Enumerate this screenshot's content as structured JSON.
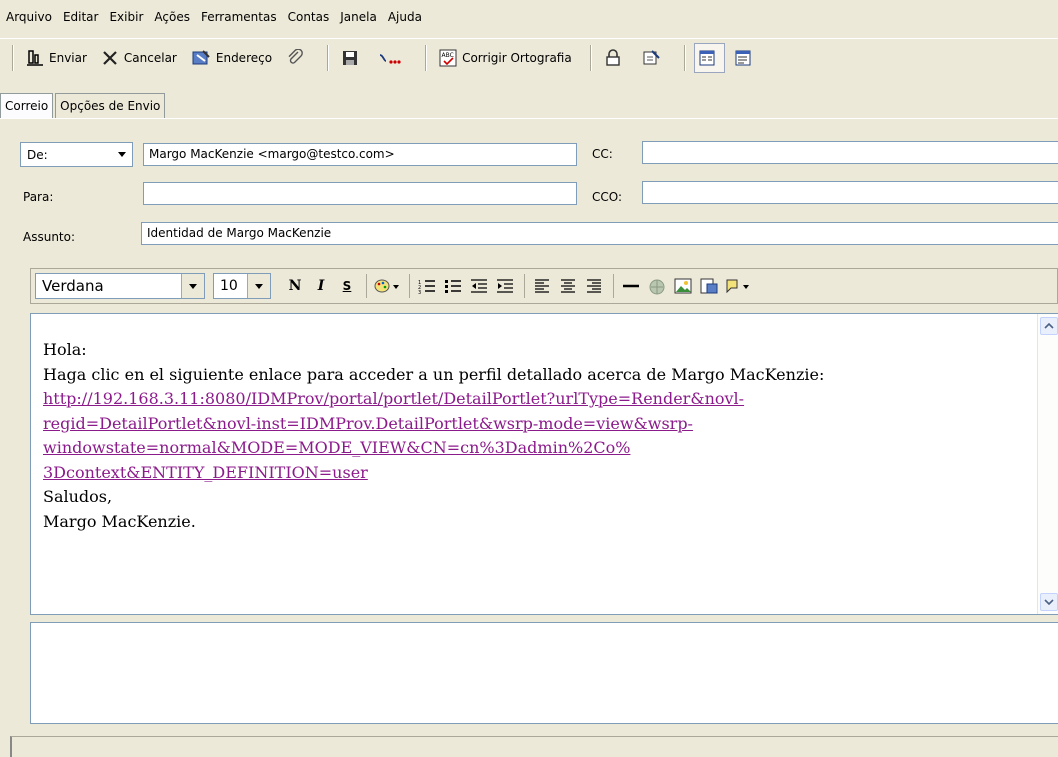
{
  "menu": [
    "Arquivo",
    "Editar",
    "Exibir",
    "Ações",
    "Ferramentas",
    "Contas",
    "Janela",
    "Ajuda"
  ],
  "toolbar": {
    "send": "Enviar",
    "cancel": "Cancelar",
    "address": "Endereço",
    "spell": "Corrigir Ortografia"
  },
  "tabs": [
    "Correio",
    "Opções de Envio"
  ],
  "form": {
    "from_label": "De:",
    "from_value": "Margo MacKenzie <margo@testco.com>",
    "cc_label": "CC:",
    "cc_value": "",
    "to_label": "Para:",
    "to_value": "",
    "bcc_label": "CCO:",
    "bcc_value": "",
    "subject_label": "Assunto:",
    "subject_value": "Identidad de Margo MacKenzie"
  },
  "format": {
    "font": "Verdana",
    "size": "10"
  },
  "message": {
    "greeting": "Hola:",
    "intro": "Haga clic en el siguiente enlace para acceder a un perfil detallado acerca de Margo MacKenzie:",
    "link_lines": [
      "http://192.168.3.11:8080/IDMProv/portal/portlet/DetailPortlet?urlType=Render&novl-",
      "regid=DetailPortlet&novl-inst=IDMProv.DetailPortlet&wsrp-mode=view&wsrp-",
      "windowstate=normal&MODE=MODE_VIEW&CN=cn%3Dadmin%2Co%",
      "3Dcontext&ENTITY_DEFINITION=user"
    ],
    "closing": "Saludos,",
    "signature": "Margo MacKenzie."
  },
  "colors": {
    "chrome": "#ece9d8",
    "link": "#8b1a8b",
    "field_border": "#7f9db9"
  }
}
